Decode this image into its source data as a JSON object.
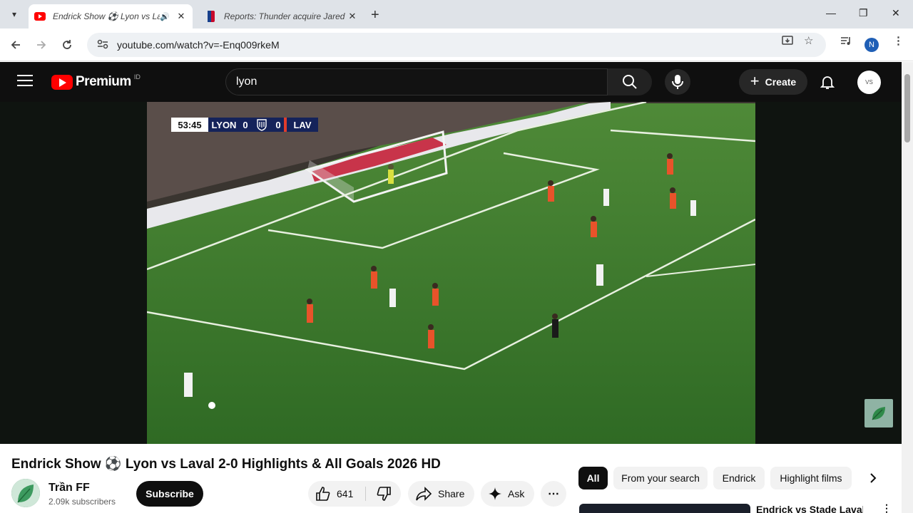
{
  "browser": {
    "tabs": [
      {
        "title": "Endrick Show ⚽ Lyon vs Laval",
        "active": true
      },
      {
        "title": "Reports: Thunder acquire Jared",
        "active": false
      }
    ],
    "url": "youtube.com/watch?v=-Enq009rkeM",
    "profile_initial": "N"
  },
  "youtube": {
    "brand": "Premium",
    "country_code": "ID",
    "search_value": "lyon",
    "create_label": "Create",
    "account_initials": "VS"
  },
  "video": {
    "scorebug": {
      "time": "53:45",
      "home": "LYON",
      "home_score": "0",
      "away_score": "0",
      "away": "LAV"
    },
    "title": "Endrick Show ⚽ Lyon vs Laval 2-0 Highlights & All Goals 2026 HD",
    "channel": "Trần FF",
    "subscribers": "2.09k subscribers",
    "subscribe_label": "Subscribe",
    "likes": "641",
    "share_label": "Share",
    "ask_label": "Ask"
  },
  "chips": [
    "All",
    "From your search",
    "Endrick",
    "Highlight films"
  ],
  "recommended": [
    {
      "title": "Endrick vs Stade Laval |"
    }
  ],
  "colors": {
    "youtube_red": "#ff0000",
    "dark_bg": "#0f0f0f",
    "pitch_green": "#3f7a2e",
    "lyon_navy": "#15235a",
    "laval_orange": "#e8532a"
  }
}
